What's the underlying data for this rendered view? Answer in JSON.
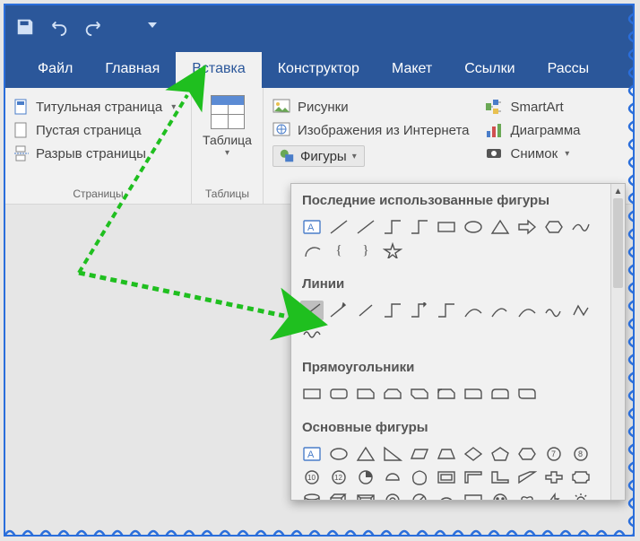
{
  "titlebar": {
    "icons": {
      "save": "save-icon",
      "undo": "undo-icon",
      "redo": "redo-icon",
      "customize": "customize-icon"
    }
  },
  "tabs": {
    "file": "Файл",
    "home": "Главная",
    "insert": "Вставка",
    "design": "Конструктор",
    "layout": "Макет",
    "references": "Ссылки",
    "mailings": "Рассы"
  },
  "ribbon": {
    "pages": {
      "cover_page": "Титульная страница",
      "blank_page": "Пустая страница",
      "page_break": "Разрыв страницы",
      "group_label": "Страницы"
    },
    "tables": {
      "table": "Таблица",
      "group_label": "Таблицы"
    },
    "illustrations": {
      "pictures": "Рисунки",
      "online_pictures": "Изображения из Интернета",
      "shapes": "Фигуры",
      "smartart": "SmartArt",
      "chart": "Диаграмма",
      "screenshot": "Снимок"
    }
  },
  "shapes_panel": {
    "recent": "Последние использованные фигуры",
    "lines": "Линии",
    "rectangles": "Прямоугольники",
    "basic_shapes": "Основные фигуры"
  }
}
